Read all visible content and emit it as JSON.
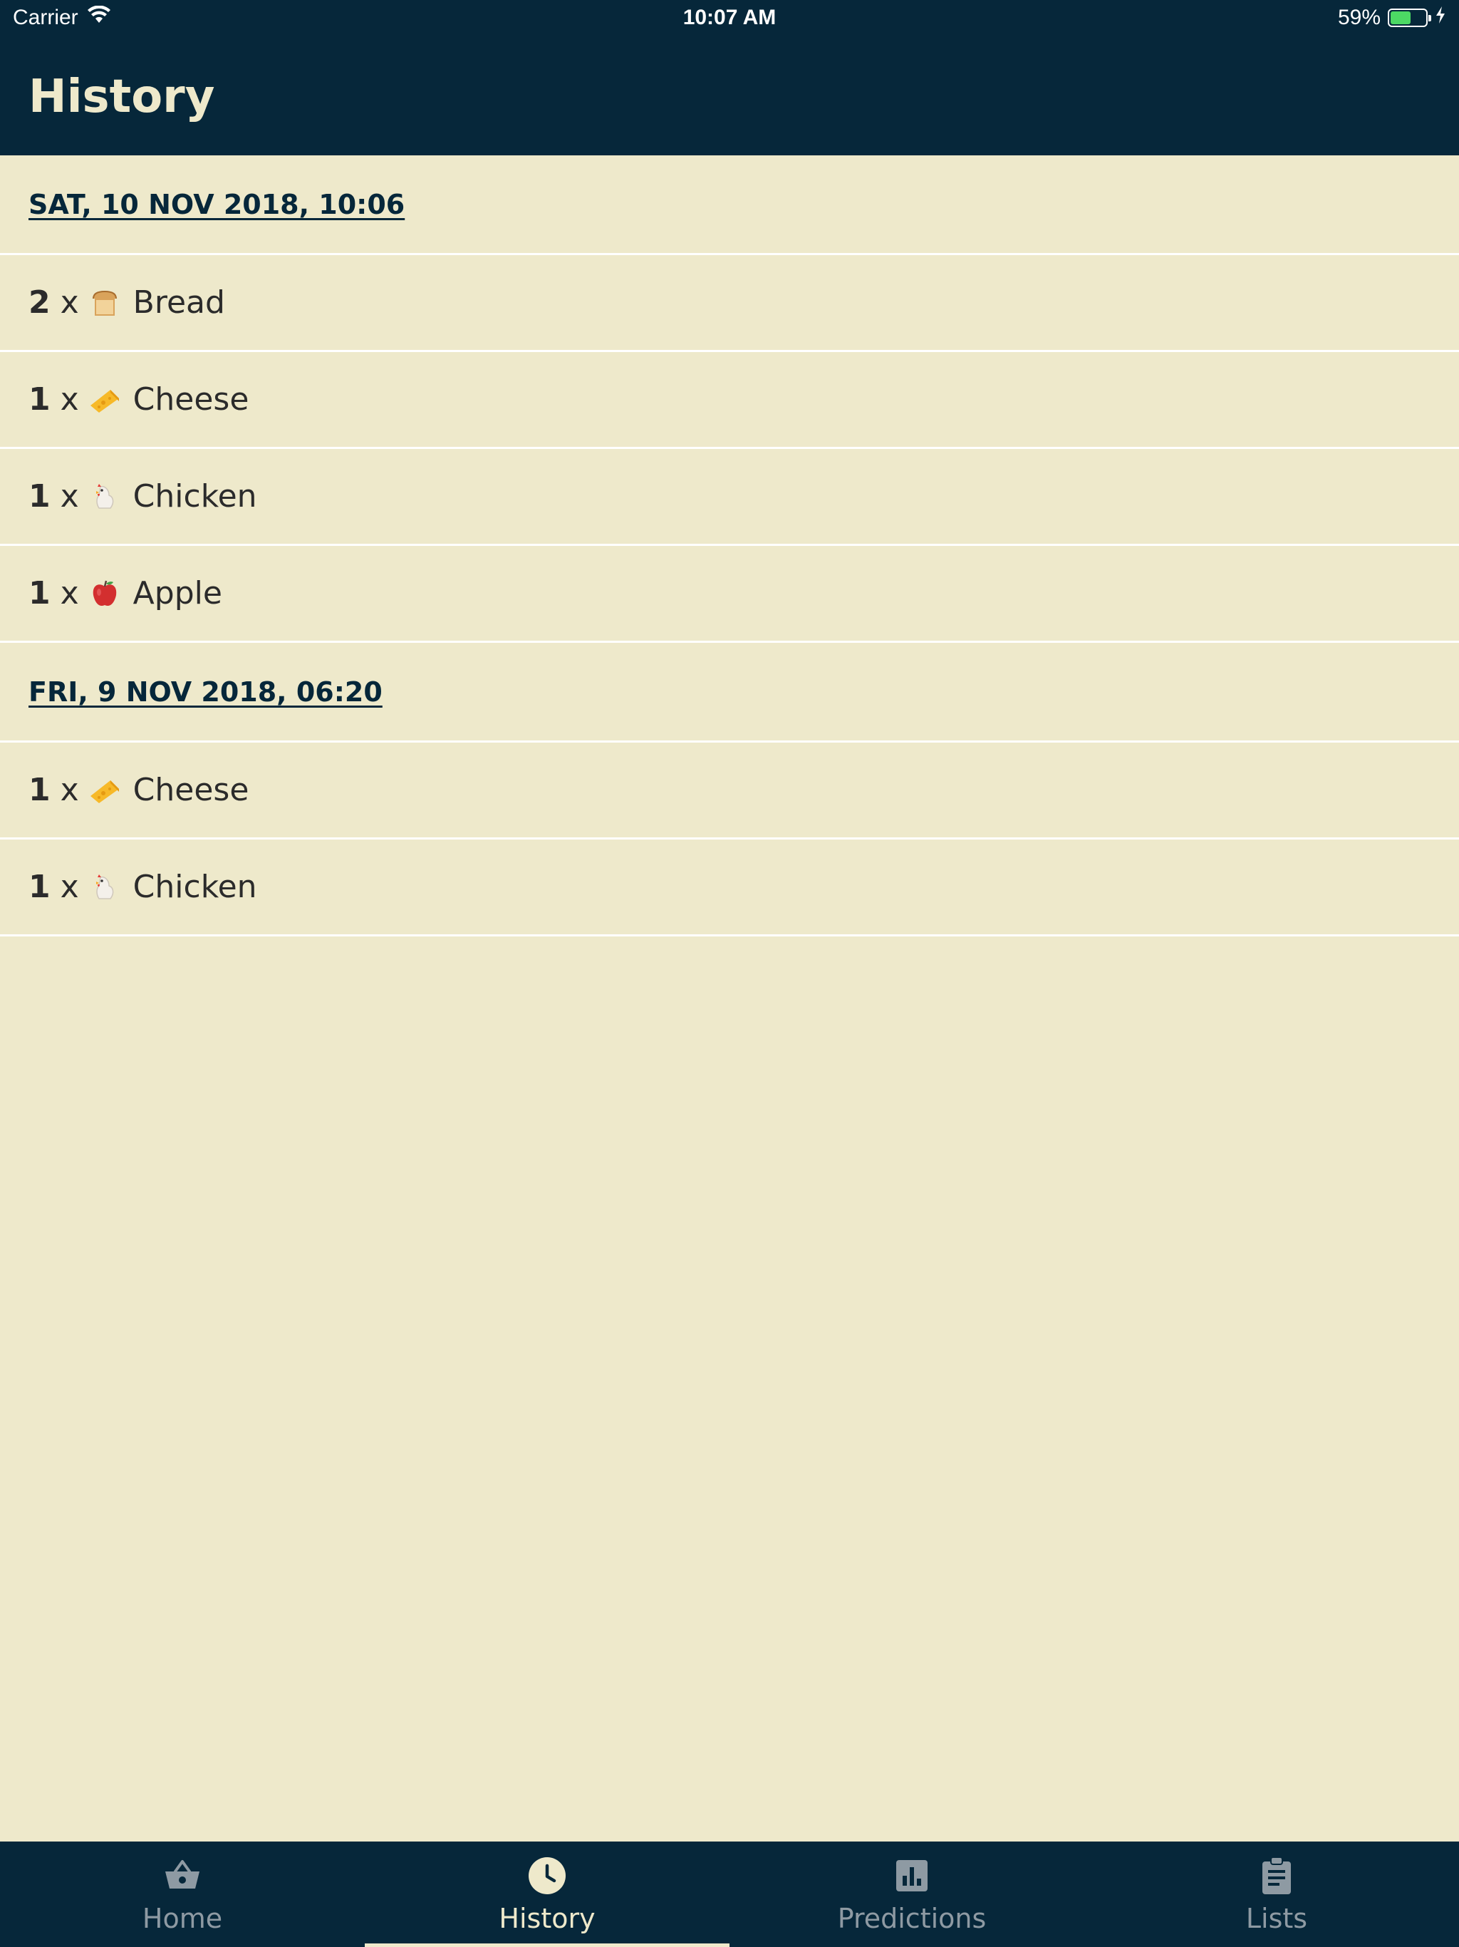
{
  "status_bar": {
    "carrier": "Carrier",
    "time": "10:07 AM",
    "battery_percent_label": "59%",
    "battery_level": 0.59,
    "battery_color": "#4CD964"
  },
  "header": {
    "title": "History"
  },
  "history": {
    "groups": [
      {
        "date": "SAT, 10 NOV 2018, 10:06",
        "items": [
          {
            "qty": "2",
            "x": "x",
            "icon": "bread-icon",
            "name": "Bread"
          },
          {
            "qty": "1",
            "x": "x",
            "icon": "cheese-icon",
            "name": "Cheese"
          },
          {
            "qty": "1",
            "x": "x",
            "icon": "chicken-icon",
            "name": "Chicken"
          },
          {
            "qty": "1",
            "x": "x",
            "icon": "apple-icon",
            "name": "Apple"
          }
        ]
      },
      {
        "date": "FRI, 9 NOV 2018, 06:20",
        "items": [
          {
            "qty": "1",
            "x": "x",
            "icon": "cheese-icon",
            "name": "Cheese"
          },
          {
            "qty": "1",
            "x": "x",
            "icon": "chicken-icon",
            "name": "Chicken"
          }
        ]
      }
    ]
  },
  "tabs": {
    "items": [
      {
        "label": "Home",
        "icon": "basket-icon",
        "active": false
      },
      {
        "label": "History",
        "icon": "clock-icon",
        "active": true
      },
      {
        "label": "Predictions",
        "icon": "bar-chart-icon",
        "active": false
      },
      {
        "label": "Lists",
        "icon": "clipboard-icon",
        "active": false
      }
    ]
  },
  "colors": {
    "primary_dark": "#06273A",
    "background": "#EEE9CB",
    "divider": "#FFFFFF",
    "inactive_tab": "#8E9AA3"
  }
}
